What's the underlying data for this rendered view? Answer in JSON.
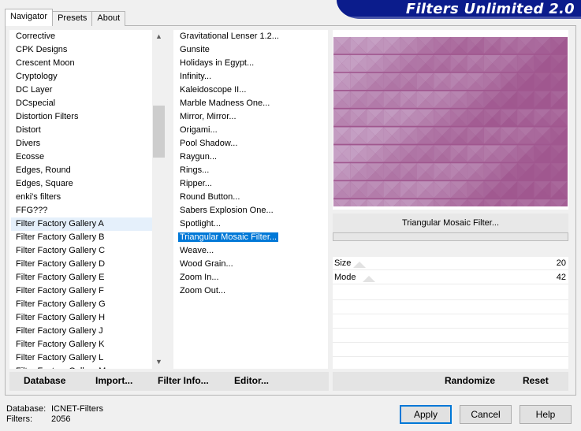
{
  "tabs": [
    "Navigator",
    "Presets",
    "About"
  ],
  "banner_title": "Filters Unlimited 2.0",
  "categories": [
    "Corrective",
    "CPK Designs",
    "Crescent Moon",
    "Cryptology",
    "DC Layer",
    "DCspecial",
    "Distortion Filters",
    "Distort",
    "Divers",
    "Ecosse",
    "Edges, Round",
    "Edges, Square",
    "enki's filters",
    "FFG???",
    "Filter Factory Gallery A",
    "Filter Factory Gallery B",
    "Filter Factory Gallery C",
    "Filter Factory Gallery D",
    "Filter Factory Gallery E",
    "Filter Factory Gallery F",
    "Filter Factory Gallery G",
    "Filter Factory Gallery H",
    "Filter Factory Gallery J",
    "Filter Factory Gallery K",
    "Filter Factory Gallery L",
    "Filter Factory Gallery M"
  ],
  "filters": [
    "Gravitational Lenser 1.2...",
    "Gunsite",
    "Holidays in Egypt...",
    "Infinity...",
    "Kaleidoscope II...",
    "Marble Madness One...",
    "Mirror, Mirror...",
    "Origami...",
    "Pool Shadow...",
    "Raygun...",
    "Rings...",
    "Ripper...",
    "Round Button...",
    "Sabers Explosion One...",
    "Spotlight...",
    "Triangular Mosaic Filter...",
    "Weave...",
    "Wood Grain...",
    "Zoom In...",
    "Zoom Out..."
  ],
  "selected_filter": "Triangular Mosaic Filter...",
  "preview": {
    "filter_name": "Triangular Mosaic Filter...",
    "base_color": "#a0578f",
    "light_color": "#c6a1c5"
  },
  "params": [
    {
      "label": "Size",
      "value": "20"
    },
    {
      "label": "Mode",
      "value": "42"
    }
  ],
  "toolbar": {
    "database": "Database",
    "import": "Import...",
    "filter_info": "Filter Info...",
    "editor": "Editor..."
  },
  "actions": {
    "randomize": "Randomize",
    "reset": "Reset"
  },
  "status": {
    "database_label": "Database:",
    "database_value": "ICNET-Filters",
    "filters_label": "Filters:",
    "filters_value": "2056"
  },
  "buttons": {
    "apply": "Apply",
    "cancel": "Cancel",
    "help": "Help"
  }
}
